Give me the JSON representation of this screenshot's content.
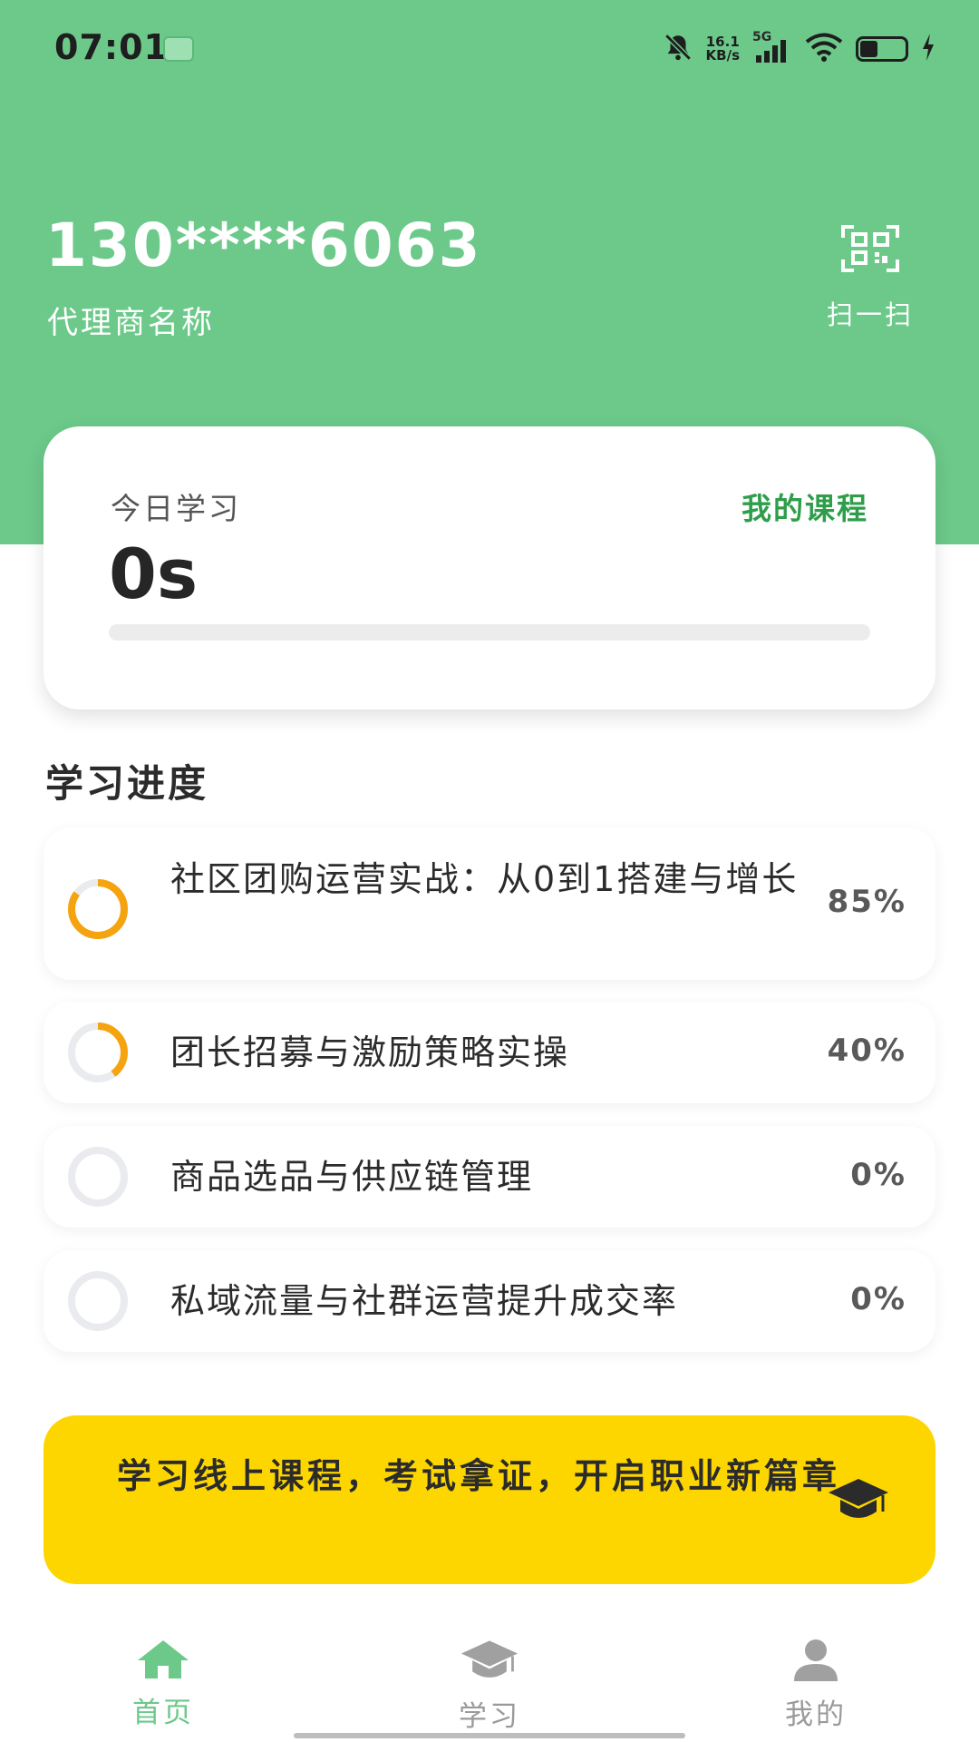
{
  "status_bar": {
    "time": "07:01",
    "net_speed_value": "16.1",
    "net_speed_unit": "KB/s",
    "network": "5G",
    "battery_level": 0.4
  },
  "user": {
    "phone": "130****6063",
    "agent_name": "代理商名称"
  },
  "scan": {
    "label": "扫一扫",
    "icon": "qr-scan-icon"
  },
  "today": {
    "label": "今日学习",
    "value": "0s",
    "my_courses_link": "我的课程",
    "progress": 0
  },
  "progress_section": {
    "title": "学习进度",
    "courses": [
      {
        "title": "社区团购运营实战：从0到1搭建与增长",
        "percent_label": "85%",
        "progress": 0.85
      },
      {
        "title": "团长招募与激励策略实操",
        "percent_label": "40%",
        "progress": 0.4
      },
      {
        "title": "商品选品与供应链管理",
        "percent_label": "0%",
        "progress": 0
      },
      {
        "title": "私域流量与社群运营提升成交率",
        "percent_label": "0%",
        "progress": 0
      }
    ]
  },
  "banner": {
    "text": "学习线上课程，考试拿证，开启职业新篇章",
    "icon": "graduation-cap-icon"
  },
  "tabbar": {
    "tabs": [
      {
        "label": "首页",
        "icon": "home-icon",
        "active": true
      },
      {
        "label": "学习",
        "icon": "graduation-cap-icon",
        "active": false
      },
      {
        "label": "我的",
        "icon": "user-icon",
        "active": false
      }
    ]
  },
  "colors": {
    "brand_green": "#6cc98a",
    "link_green": "#2e9e4b",
    "ring_orange": "#f5a30f",
    "ring_track": "#e9ebee",
    "banner_yellow": "#fdd600",
    "tab_inactive": "#9a9a9a"
  }
}
